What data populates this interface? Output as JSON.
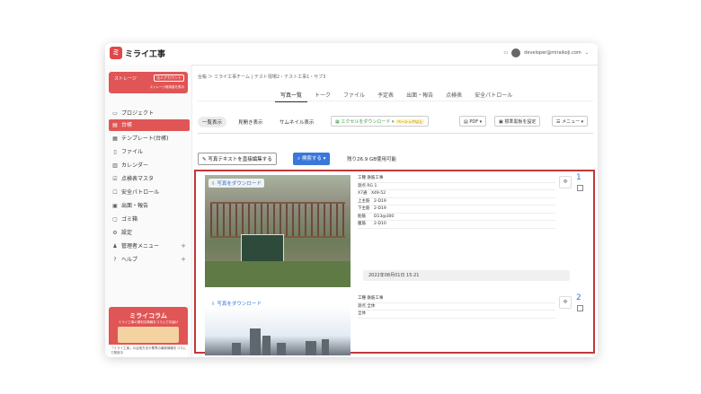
{
  "app": {
    "logo_text": "ミライ工事",
    "logo_mark": "ミ",
    "user_email": "developer@miraikoji.com"
  },
  "sidebar": {
    "storage": {
      "label": "ストレージ",
      "badge": "法人アカウント",
      "sub": "ストレージ使用量を表示"
    },
    "items": [
      {
        "label": "プロジェクト",
        "icon": "folder-icon",
        "glyph": "▭"
      },
      {
        "label": "台帳",
        "icon": "ledger-icon",
        "glyph": "▤"
      },
      {
        "label": "テンプレート(台帳)",
        "icon": "template-icon",
        "glyph": "▦"
      },
      {
        "label": "ファイル",
        "icon": "file-icon",
        "glyph": "▯"
      },
      {
        "label": "カレンダー",
        "icon": "calendar-icon",
        "glyph": "▥"
      },
      {
        "label": "点検表マスタ",
        "icon": "checklist-icon",
        "glyph": "☑"
      },
      {
        "label": "安全パトロール",
        "icon": "safety-icon",
        "glyph": "☐"
      },
      {
        "label": "出面・報告",
        "icon": "report-icon",
        "glyph": "▣"
      },
      {
        "label": "ゴミ箱",
        "icon": "trash-icon",
        "glyph": "▢"
      },
      {
        "label": "設定",
        "icon": "gear-icon",
        "glyph": "⚙"
      },
      {
        "label": "管理者メニュー",
        "icon": "admin-icon",
        "glyph": "♟"
      },
      {
        "label": "ヘルプ",
        "icon": "help-icon",
        "glyph": "?"
      }
    ],
    "promo": {
      "title": "ミライコラム",
      "sub": "ミライ工事の便利な情報をコラムでお届け",
      "note": "「ミライ工事」の活用方法や業界の最新情報をコラムで発信中"
    }
  },
  "main": {
    "breadcrumb": "台帳 ＞ ミライ工事チーム | テスト現場2・テスト工事1・サブ3",
    "tabs": [
      "写真一覧",
      "トーク",
      "ファイル",
      "予定表",
      "出面・報告",
      "点検表",
      "安全パトロール"
    ],
    "view_buttons": [
      "一覧表示",
      "見開き表示",
      "サムネイル表示"
    ],
    "toolbar": {
      "excel": "エクセルをダウンロード",
      "excel_badge": "ベーシック以上",
      "pdf": "PDF",
      "template": "標準黒板を設定",
      "menu": "メニュー"
    },
    "edit_text_button": "写真テキストを直接編集する",
    "search_button": "検索する",
    "remaining": "残り26.9 GB使用可能"
  },
  "photos": [
    {
      "download": "写真をダウンロード",
      "rows": [
        "工種 鉄筋工事",
        "測点 RG 1",
        "X7通　X49-52",
        "上主筋　2-D19",
        "下主筋　2-D19",
        "肋筋　　D13@300",
        "腹筋　　2-D10"
      ],
      "date": "2022年08月01日 15:21",
      "number": "1"
    },
    {
      "download": "写真をダウンロード",
      "rows": [
        "工種 鉄筋工事",
        "測点 全体",
        "全体"
      ],
      "number": "2"
    }
  ],
  "colors": {
    "accent": "#e05555",
    "primary": "#3a77d8",
    "frame": "#c0393b"
  }
}
